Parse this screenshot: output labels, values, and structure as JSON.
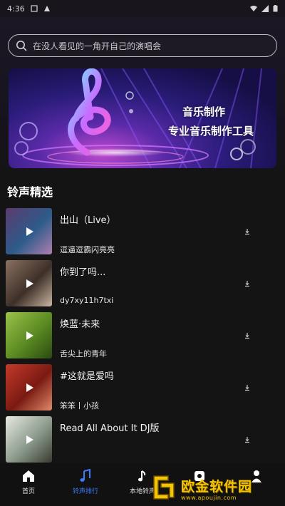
{
  "status_bar": {
    "time": "4:36"
  },
  "search": {
    "placeholder": "在没人看见的一角开自己的演唱会"
  },
  "banner": {
    "line1": "音乐制作",
    "line2": "专业音乐制作工具"
  },
  "section": {
    "title": "铃声精选"
  },
  "songs": [
    {
      "title": "出山（Live）",
      "artist": "逗逼逗霸闪亮亮",
      "cover_colors": [
        "#5b3b6e",
        "#2d5b8a",
        "#b07fb0"
      ]
    },
    {
      "title": "你到了吗...",
      "artist": "dy7xy11h7txi",
      "cover_colors": [
        "#8a7060",
        "#3d3028",
        "#c9b5a0"
      ]
    },
    {
      "title": "焕蓝·未来",
      "artist": "舌尖上的青年",
      "cover_colors": [
        "#9bc24a",
        "#5a8a22",
        "#2d4a10"
      ]
    },
    {
      "title": "#这就是爱吗",
      "artist": "笨笨丨小孩",
      "cover_colors": [
        "#c43a2a",
        "#7a1a12",
        "#e08a6a"
      ]
    },
    {
      "title": "Read All About It   DJ版",
      "artist": "",
      "cover_colors": [
        "#e8e8e2",
        "#8a9a8a",
        "#3a3a30"
      ]
    }
  ],
  "bottom_nav": [
    {
      "label": "首页",
      "icon": "home-icon",
      "active": false
    },
    {
      "label": "铃声排行",
      "icon": "music-note-icon",
      "active": true
    },
    {
      "label": "本地铃声",
      "icon": "music-file-icon",
      "active": false
    },
    {
      "label": "",
      "icon": "tool-icon",
      "active": false
    },
    {
      "label": "",
      "icon": "user-icon",
      "active": false
    }
  ],
  "watermark": {
    "text": "欧金软件园",
    "url": "www.apoujin.com"
  },
  "colors": {
    "accent": "#3d7bff",
    "background": "#141414",
    "watermark": "#f5c400"
  }
}
